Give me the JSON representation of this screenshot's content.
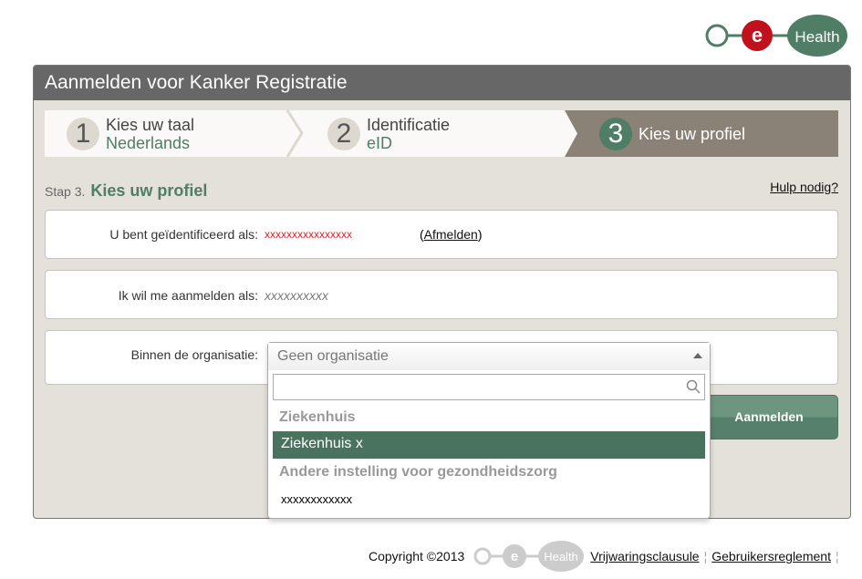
{
  "logo": {
    "text": "Health",
    "letter": "e"
  },
  "header": {
    "title": "Aanmelden voor Kanker Registratie"
  },
  "steps": [
    {
      "num": "1",
      "title": "Kies uw taal",
      "sub": "Nederlands"
    },
    {
      "num": "2",
      "title": "Identificatie",
      "sub": "eID"
    },
    {
      "num": "3",
      "title": "Kies uw profiel"
    }
  ],
  "stap": {
    "prefix": "Stap 3.",
    "title": "Kies uw profiel"
  },
  "help": "Hulp nodig?",
  "identified": {
    "label": "U bent geïdentificeerd als:",
    "value": "xxxxxxxxxxxxxxxx",
    "logout_open": "(",
    "logout": "Afmelden",
    "logout_close": ")"
  },
  "profile": {
    "label": "Ik wil me aanmelden als:",
    "value": "xxxxxxxxxx"
  },
  "organisation": {
    "label": "Binnen de organisatie:",
    "selected": "Geen organisatie",
    "search_value": "",
    "groups": [
      {
        "label": "Ziekenhuis",
        "options": [
          "Ziekenhuis x"
        ]
      },
      {
        "label": "Andere instelling voor gezondheidszorg",
        "options": [
          "xxxxxxxxxxxx"
        ]
      }
    ]
  },
  "submit": "Aanmelden",
  "footer": {
    "copyright": "Copyright ©2013",
    "links": [
      "Vrijwaringsclausule",
      "Gebruikersreglement"
    ]
  },
  "colors": {
    "accent": "#4f7d66",
    "header": "#676767",
    "error": "#e8202a",
    "logo_red": "#c0121c"
  }
}
